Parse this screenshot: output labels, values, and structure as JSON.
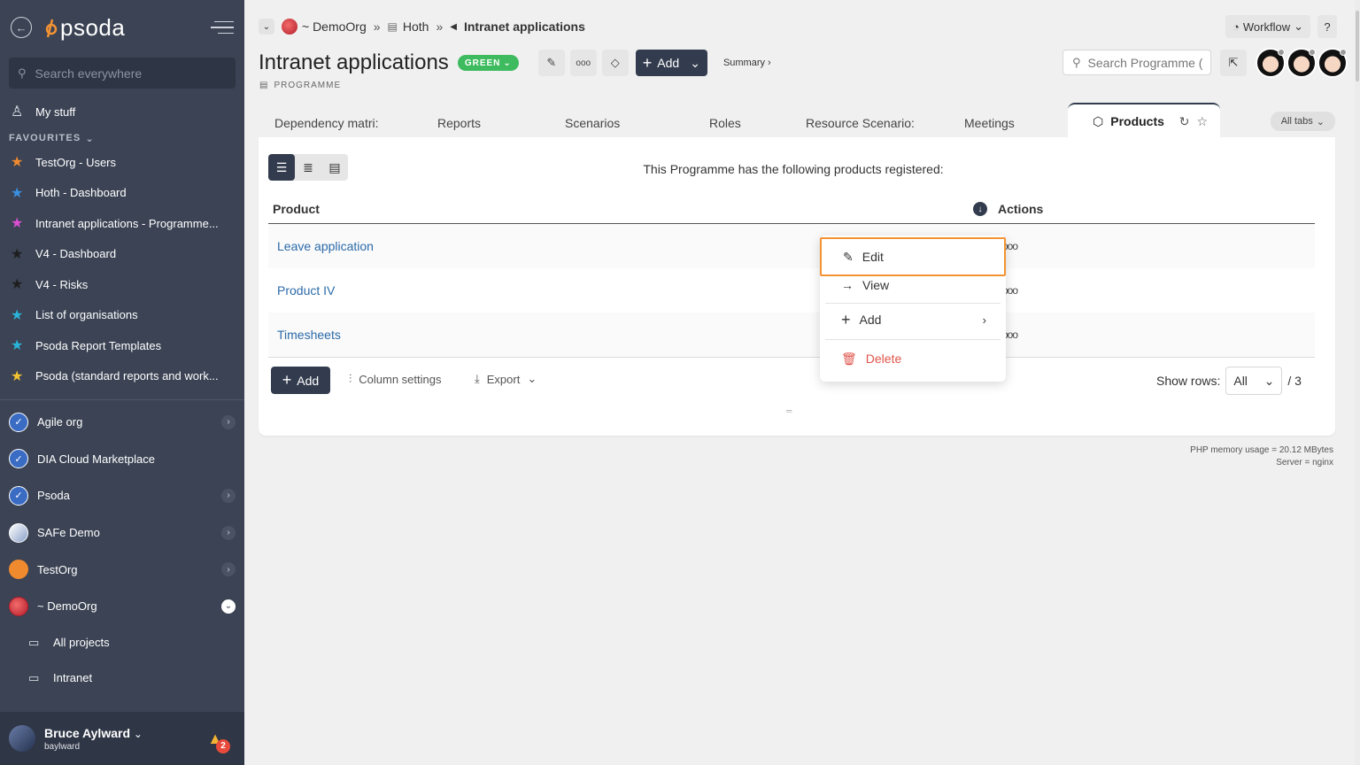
{
  "app": {
    "logo_text": "psoda"
  },
  "sidebar": {
    "search_placeholder": "Search everywhere",
    "my_stuff": "My stuff",
    "favourites_label": "FAVOURITES",
    "favourites": [
      {
        "label": "TestOrg - Users",
        "color": "#f08a2e"
      },
      {
        "label": "Hoth - Dashboard",
        "color": "#3a8fe0"
      },
      {
        "label": "Intranet applications - Programme...",
        "color": "#d94fd2"
      },
      {
        "label": "V4 - Dashboard",
        "color": "#2b2b2b"
      },
      {
        "label": "V4 - Risks",
        "color": "#2b2b2b"
      },
      {
        "label": "List of organisations",
        "color": "#2ab3d9"
      },
      {
        "label": "Psoda Report Templates",
        "color": "#2ab3d9"
      },
      {
        "label": "Psoda (standard reports and work...",
        "color": "#f2c230"
      }
    ],
    "orgs": [
      {
        "label": "Agile org",
        "has_chevron": true
      },
      {
        "label": "DIA Cloud Marketplace",
        "has_chevron": false
      },
      {
        "label": "Psoda",
        "has_chevron": true
      },
      {
        "label": "SAFe Demo",
        "has_chevron": true
      },
      {
        "label": "TestOrg",
        "has_chevron": true
      },
      {
        "label": "~ DemoOrg",
        "has_chevron": true,
        "open": true
      }
    ],
    "sub_items": [
      "All projects",
      "Intranet"
    ],
    "user": {
      "name": "Bruce Aylward",
      "login": "baylward",
      "notifications": "2"
    }
  },
  "breadcrumb": {
    "org": "~ DemoOrg",
    "sep": "»",
    "parent": "Hoth",
    "current": "Intranet applications"
  },
  "top_right": {
    "workflow": "Workflow",
    "help": "?"
  },
  "page": {
    "title": "Intranet applications",
    "status": "GREEN",
    "add_label": "Add",
    "summary_link": "Summary ›",
    "type_label": "PROGRAMME",
    "search_placeholder": "Search Programme (",
    "dots": "ooo"
  },
  "tabs": {
    "items": [
      "Dependency matri:",
      "Reports",
      "Scenarios",
      "Roles",
      "Resource Scenario:",
      "Meetings"
    ],
    "active": "Products",
    "all_tabs": "All tabs"
  },
  "panel": {
    "intro": "This Programme has the following products registered:",
    "columns": {
      "product": "Product",
      "actions": "Actions"
    },
    "rows": [
      "Leave application",
      "Product IV",
      "Timesheets"
    ],
    "row_actions": "ooo",
    "add_label": "Add",
    "column_settings": "Column settings",
    "export": "Export",
    "show_rows_label": "Show rows:",
    "show_rows_value": "All",
    "total": "/ 3"
  },
  "context_menu": {
    "items": [
      "Edit",
      "View",
      "Add",
      "Delete"
    ],
    "highlight_color": "#f39233",
    "danger_color": "#e0544b"
  },
  "footer": {
    "memory": "PHP memory usage = 20.12 MBytes",
    "server": "Server = nginx"
  }
}
